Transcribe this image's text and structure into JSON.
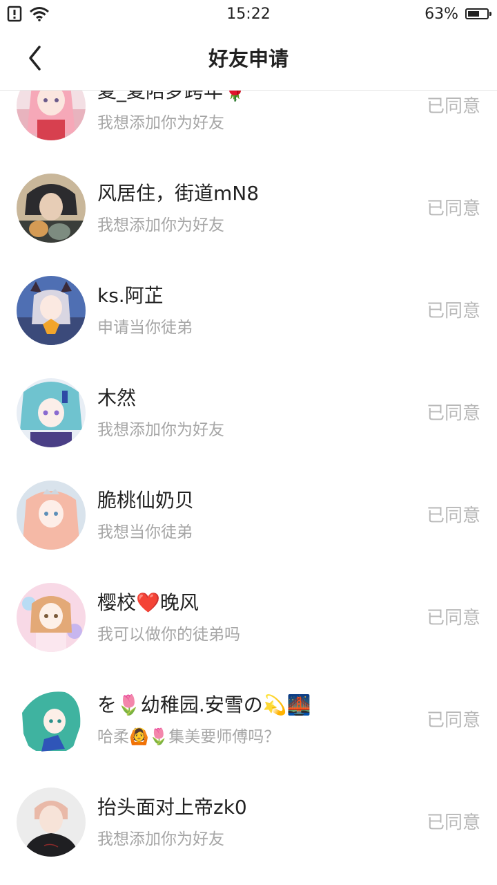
{
  "status_bar": {
    "time": "15:22",
    "battery_percent": "63%",
    "battery_level": 0.63
  },
  "header": {
    "title": "好友申请"
  },
  "requests": [
    {
      "name": "夏_夏陪梦跨年🌹",
      "message": "我想添加你为好友",
      "status": "已同意"
    },
    {
      "name": "风居住，街道mN8",
      "message": "我想添加你为好友",
      "status": "已同意"
    },
    {
      "name": "ks.阿芷",
      "message": "申请当你徒弟",
      "status": "已同意"
    },
    {
      "name": "木然",
      "message": "我想添加你为好友",
      "status": "已同意"
    },
    {
      "name": "脆桃仙奶贝",
      "message": "我想当你徒弟",
      "status": "已同意"
    },
    {
      "name": "樱校❤️晚风",
      "message": "我可以做你的徒弟吗",
      "status": "已同意"
    },
    {
      "name": "を🌷幼稚园.安雪の💫🌉",
      "message": "哈柔🙆🌷集美要师傅吗？",
      "status": "已同意"
    },
    {
      "name": "抬头面对上帝zk0",
      "message": "我想添加你为好友",
      "status": "已同意"
    }
  ]
}
